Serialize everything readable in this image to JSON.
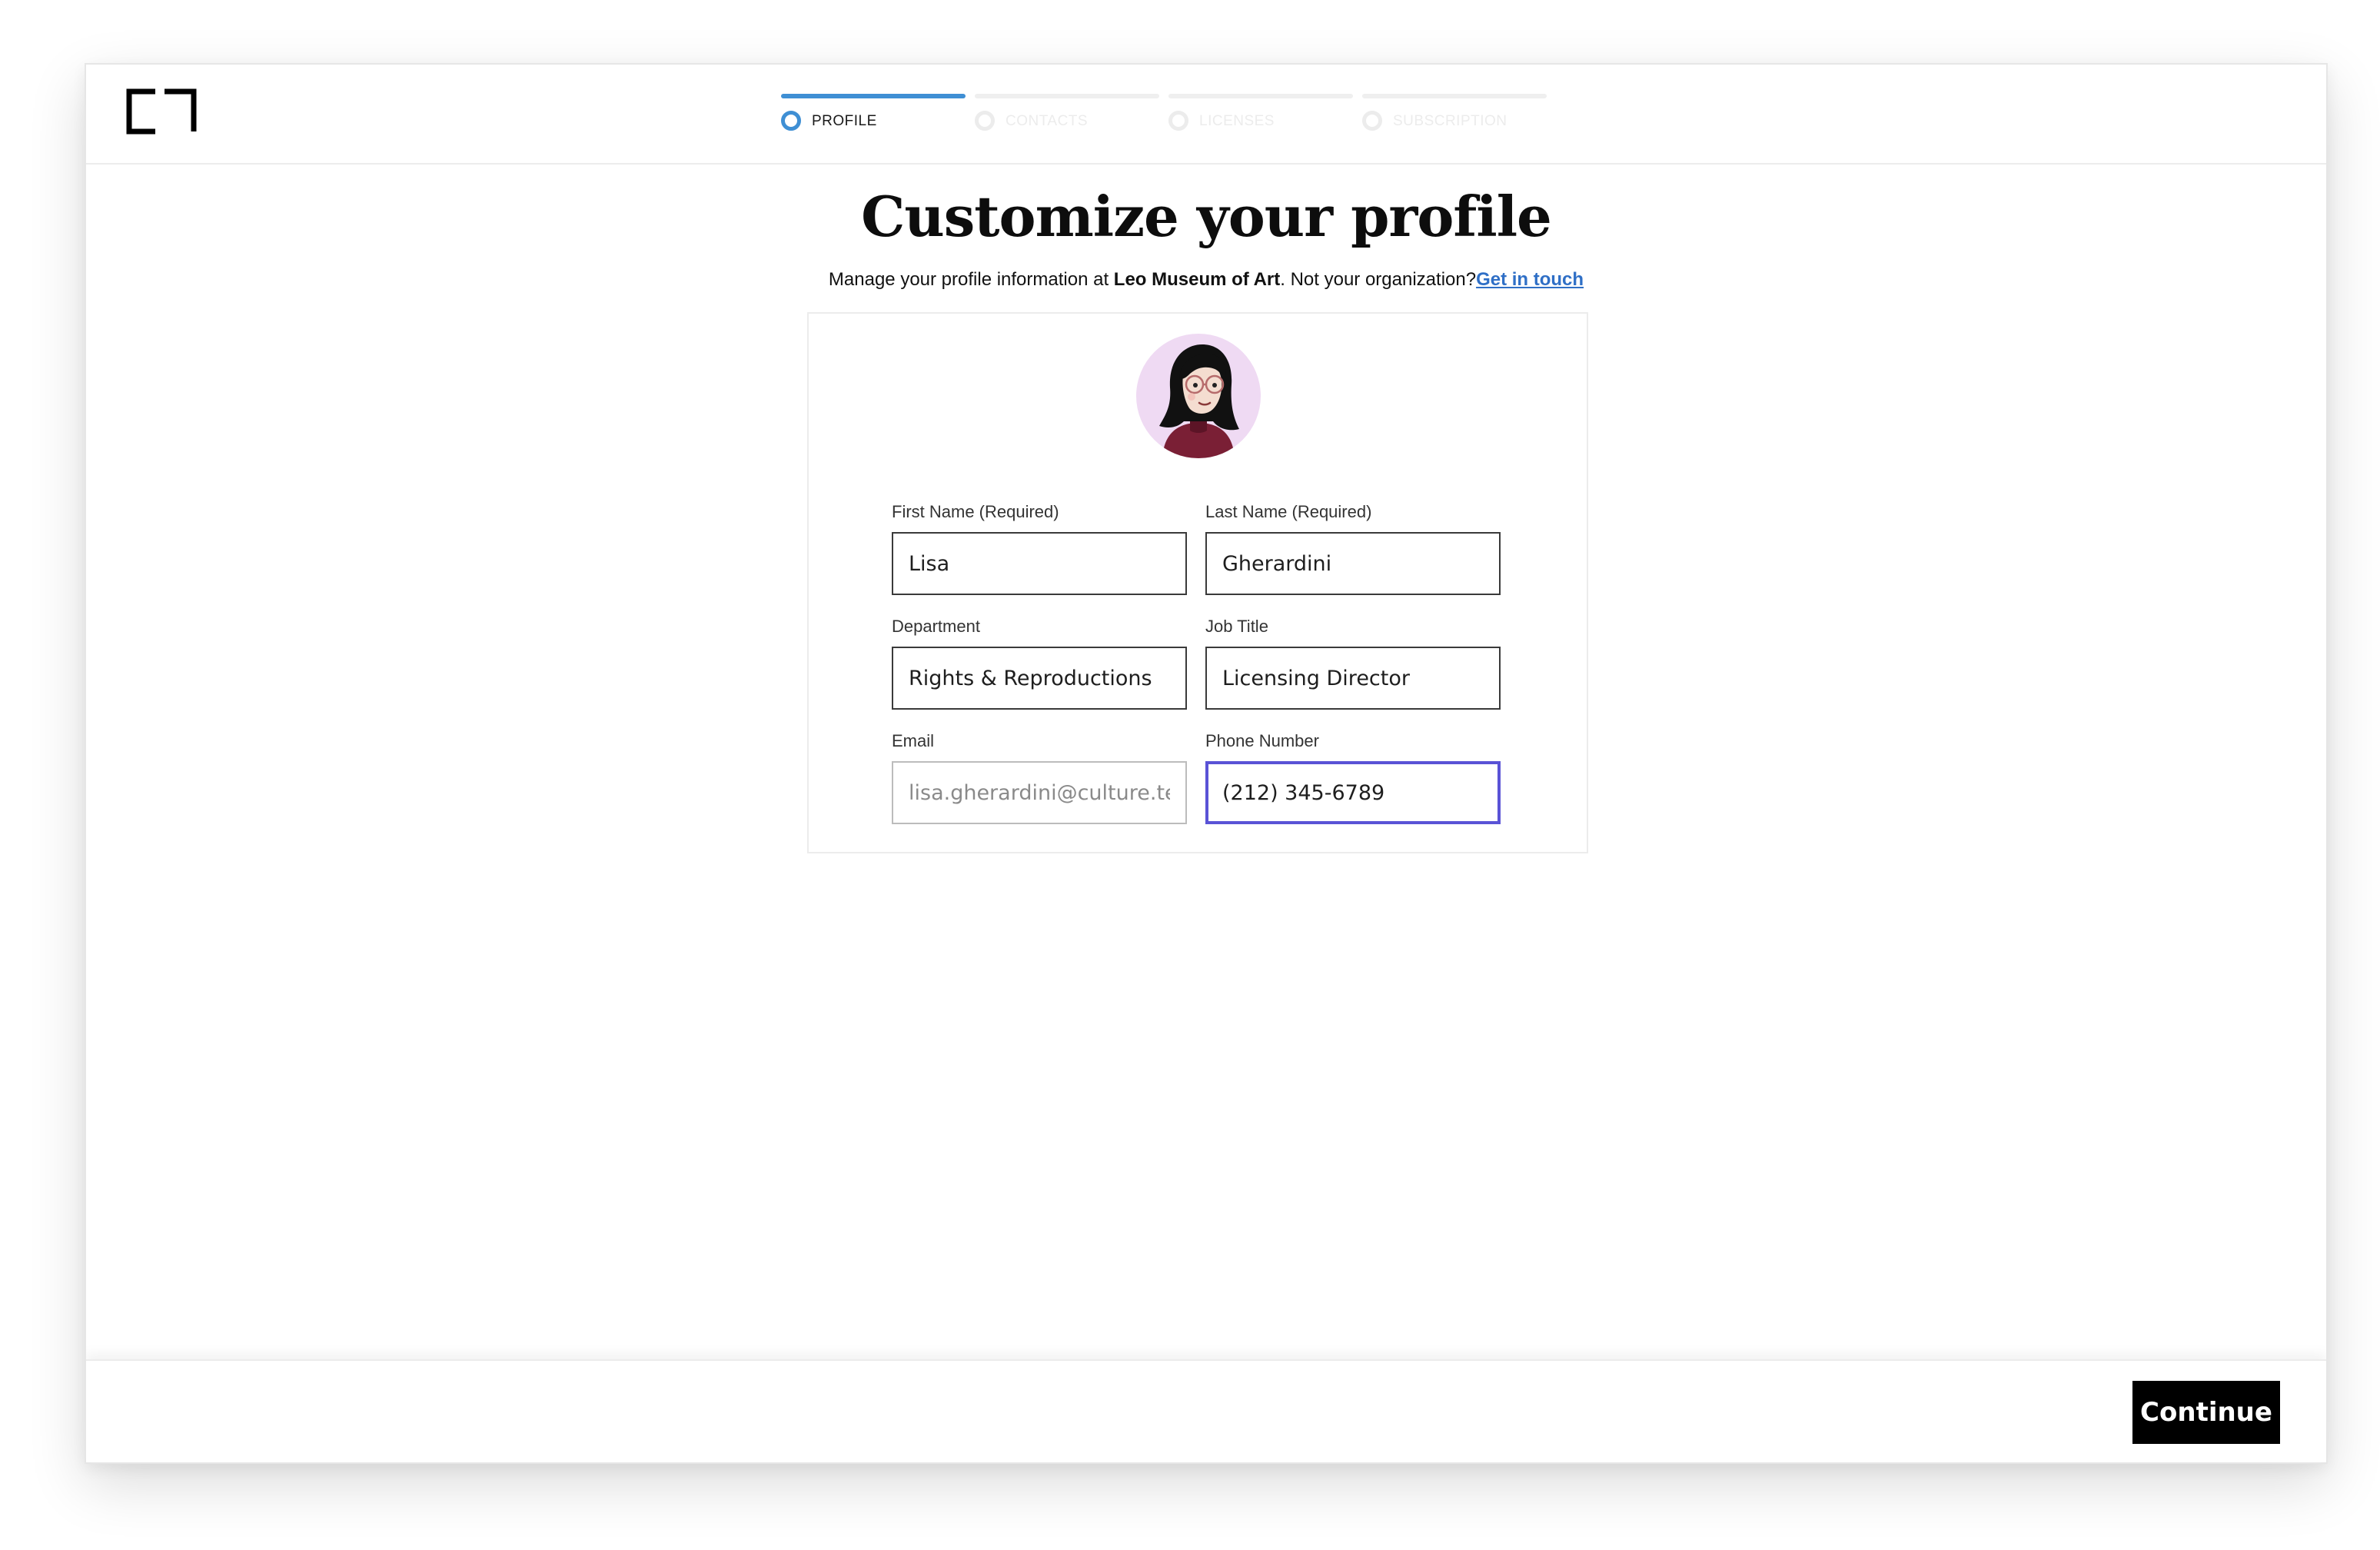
{
  "header": {
    "logo_icon": "bracket-logo-icon",
    "steps": [
      {
        "label": "PROFILE",
        "state": "active"
      },
      {
        "label": "CONTACTS",
        "state": "inactive"
      },
      {
        "label": "LICENSES",
        "state": "inactive"
      },
      {
        "label": "SUBSCRIPTION",
        "state": "inactive"
      }
    ],
    "progress": {
      "current_step": 1,
      "total_steps": 4
    }
  },
  "main": {
    "title": "Customize your profile",
    "subtitle": {
      "prefix": "Manage your profile information at ",
      "organization": "Leo Museum of Art",
      "suffix": ". Not your organization?",
      "link": "Get in touch"
    }
  },
  "profile": {
    "avatar_icon": "user-avatar-icon",
    "fields": {
      "first_name": {
        "label": "First Name (Required)",
        "value": "Lisa"
      },
      "last_name": {
        "label": "Last Name (Required)",
        "value": "Gherardini"
      },
      "department": {
        "label": "Department",
        "value": "Rights & Reproductions"
      },
      "job_title": {
        "label": "Job Title",
        "value": "Licensing Director"
      },
      "email": {
        "label": "Email",
        "value": "lisa.gherardini@culture.tec",
        "state": "disabled"
      },
      "phone": {
        "label": "Phone Number",
        "value": "(212) 345-6789",
        "state": "focused"
      }
    }
  },
  "footer": {
    "continue_label": "Continue"
  },
  "colors": {
    "accent": "#3f8fd4",
    "focus": "#5a53d6",
    "link": "#2f6fc6",
    "avatar_bg": "#efdaf3",
    "button": "#000000"
  }
}
